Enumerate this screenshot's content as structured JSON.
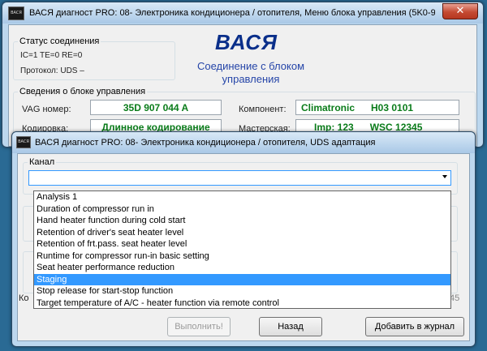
{
  "main_window": {
    "title": "ВАСЯ диагност PRO: 08- Электроника кондиционера / отопителя,  Меню блока управления (5K0-907...",
    "close_label": "✕",
    "app_icon_label": "ВАСЯ",
    "status_group": {
      "legend": "Статус соединения",
      "line1": "IC=1  TE=0  RE=0",
      "line2": "Протокол: UDS         –"
    },
    "brand": {
      "title": "ВАСЯ",
      "subtitle": "Соединение с блоком управления"
    },
    "info_group": {
      "legend": "Сведения о блоке управления",
      "vag_label": "VAG номер:",
      "vag_value": "35D 907 044 A",
      "component_label": "Компонент:",
      "component_value": "Climatronic      H03 0101",
      "coding_label": "Кодировка:",
      "coding_value": "Длинное кодирование",
      "workshop_label": "Мастерская:",
      "workshop_value": "Imp: 123      WSC 12345"
    },
    "peek_left": "Ко",
    "peek_right": "45"
  },
  "dialog": {
    "title": "ВАСЯ диагност PRO: 08- Электроника кондиционера / отопителя,  UDS адаптация",
    "app_icon_label": "ВАСЯ",
    "close_label": "✕",
    "channel_legend": "Канал",
    "combo_value": "",
    "options": [
      "Analysis 1",
      "Duration of compressor run in",
      "Hand heater function during cold start",
      "Retention of driver's seat heater level",
      "Retention of frt.pass. seat heater level",
      "Runtime for compressor run-in basic setting",
      "Seat heater performance reduction",
      "Staging",
      "Stop release for start-stop function",
      "Target temperature of A/C - heater function via remote control"
    ],
    "selected_option": "Staging",
    "buttons": {
      "execute": "Выполнить!",
      "back": "Назад",
      "add_to_log": "Добавить в журнал"
    }
  }
}
